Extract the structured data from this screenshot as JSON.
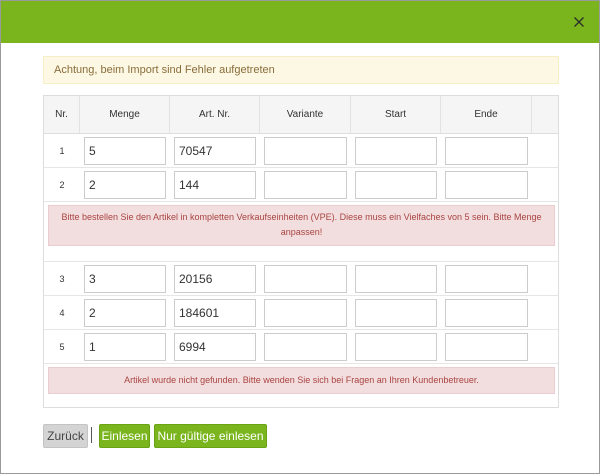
{
  "header": {
    "close_icon": "close-icon",
    "accent": "#7ab51d"
  },
  "warning": {
    "text": "Achtung, beim Import sind Fehler aufgetreten"
  },
  "table": {
    "columns": [
      "Nr.",
      "Menge",
      "Art. Nr.",
      "Variante",
      "Start",
      "Ende"
    ],
    "rows": [
      {
        "nr": "1",
        "menge": "5",
        "art_nr": "70547",
        "variante": "",
        "start": "",
        "ende": ""
      },
      {
        "nr": "2",
        "menge": "2",
        "art_nr": "144",
        "variante": "",
        "start": "",
        "ende": ""
      },
      {
        "nr": "3",
        "menge": "3",
        "art_nr": "20156",
        "variante": "",
        "start": "",
        "ende": ""
      },
      {
        "nr": "4",
        "menge": "2",
        "art_nr": "184601",
        "variante": "",
        "start": "",
        "ende": ""
      },
      {
        "nr": "5",
        "menge": "1",
        "art_nr": "6994",
        "variante": "",
        "start": "",
        "ende": ""
      }
    ],
    "errors": [
      "Bitte bestellen Sie den Artikel in kompletten Verkaufseinheiten (VPE). Diese muss ein Vielfaches von 5 sein. Bitte Menge anpassen!",
      "Artikel wurde nicht gefunden. Bitte wenden Sie sich bei Fragen an Ihren Kundenbetreuer."
    ]
  },
  "footer": {
    "back_label": "Zurück",
    "separator": "|",
    "read_label": "Einlesen",
    "read_valid_label": "Nur gültige einlesen"
  }
}
